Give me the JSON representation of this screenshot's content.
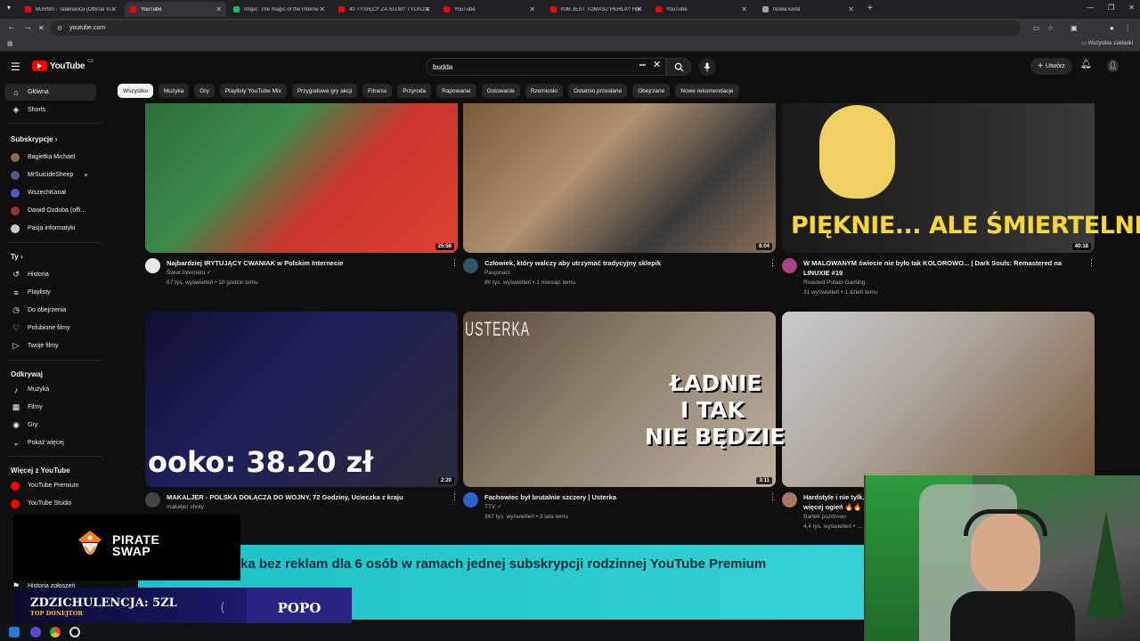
{
  "browser": {
    "tabs": [
      {
        "title": "BURNS - Talamanca (Official Vi",
        "color": "#ff0000",
        "active": false
      },
      {
        "title": "YouTube",
        "color": "#ff0000",
        "active": true
      },
      {
        "title": "Imgur: The magic of the Interne",
        "color": "#1bb76e",
        "active": false
      },
      {
        "title": "40 TYSIĘCY ZA ŚLUB? TYLKO D",
        "color": "#ff0000",
        "active": false
      },
      {
        "title": "YouTube",
        "color": "#ff0000",
        "active": false
      },
      {
        "title": "KIM JEST TOMASZ PERŁA? Hist",
        "color": "#ff0000",
        "active": false
      },
      {
        "title": "YouTube",
        "color": "#ff0000",
        "active": false
      },
      {
        "title": "Nowa karta",
        "color": "#9aa0a6",
        "active": false
      }
    ],
    "url": "youtube.com",
    "bookmarks_folder": "Wszystkie zakładki"
  },
  "header": {
    "logo": "YouTube",
    "logo_country": "CZ",
    "search_value": "budda",
    "create_label": "Utwórz"
  },
  "sidebar": {
    "main": [
      {
        "label": "Główna",
        "icon": "home-icon",
        "glyph": "⌂",
        "active": true
      },
      {
        "label": "Shorts",
        "icon": "shorts-icon",
        "glyph": "◈",
        "active": false
      }
    ],
    "subs_heading": "Subskrypcje",
    "subs": [
      {
        "label": "Bagietka Michael",
        "color": "#8a6a50"
      },
      {
        "label": "MrSuicideSheep",
        "color": "#5a5a8a",
        "new": true
      },
      {
        "label": "WszechKanał",
        "color": "#5555cc"
      },
      {
        "label": "Dawid Ozdoba (offi...",
        "color": "#993333"
      },
      {
        "label": "Pasja informatyki",
        "color": "#cccccc"
      }
    ],
    "you_heading": "Ty",
    "you": [
      {
        "label": "Historia",
        "icon": "history-icon",
        "glyph": "↺"
      },
      {
        "label": "Playlisty",
        "icon": "playlist-icon",
        "glyph": "≡"
      },
      {
        "label": "Do obejrzenia",
        "icon": "watch-later-icon",
        "glyph": "◷"
      },
      {
        "label": "Polubione filmy",
        "icon": "thumb-up-icon",
        "glyph": "♡"
      },
      {
        "label": "Twoje filmy",
        "icon": "your-videos-icon",
        "glyph": "▷"
      }
    ],
    "explore_heading": "Odkrywaj",
    "explore": [
      {
        "label": "Muzyka",
        "icon": "music-icon",
        "glyph": "♪"
      },
      {
        "label": "Filmy",
        "icon": "film-icon",
        "glyph": "▦"
      },
      {
        "label": "Gry",
        "icon": "gaming-icon",
        "glyph": "◉"
      },
      {
        "label": "Pokaż więcej",
        "icon": "chevron-down-icon",
        "glyph": "⌄"
      }
    ],
    "more_heading": "Więcej z YouTube",
    "more": [
      {
        "label": "YouTube Premium",
        "color": "#ff0000"
      },
      {
        "label": "YouTube Studio",
        "color": "#ff0000"
      }
    ],
    "bottom_item": "Historia zgłoszeń"
  },
  "chips": [
    "Wszystko",
    "Muzyka",
    "Gry",
    "Playlisty YouTube Mix",
    "Przygodowe gry akcji",
    "Fitness",
    "Przyroda",
    "Rapowanie",
    "Gotowanie",
    "Rzemiosło",
    "Ostatnio przesłane",
    "Obejrzane",
    "Nowe rekomendacje"
  ],
  "videos": [
    {
      "title": "Najbardziej IRYTUJĄCY CWANIAK w Polskim Internecie",
      "title2": "",
      "channel": "Świat Internetu ✓",
      "meta": "67 tys. wyświetleń • 10 godzin temu",
      "duration": "25:56",
      "thumb": "linear-gradient(135deg,#2d6e3c 0%,#3b8a4a 35%,#c8352c 60%,#e04030 100%)",
      "avatar": "#e8e8e8"
    },
    {
      "title": "Człowiek, który walczy aby utrzymać tradycyjny sklepik",
      "title2": "",
      "channel": "Pasjonaci",
      "meta": "80 tys. wyświetleń • 1 miesiąc temu",
      "duration": "8:04",
      "thumb": "linear-gradient(135deg,#7a5a3a 0%,#b09070 40%,#3a3a3a 70%,#8a7058 100%)",
      "avatar": "#335566"
    },
    {
      "title": "W MALOWANYM świecie nie było tak KOLOROWO... | Dark Souls: Remastered na",
      "title2": "LINUXIE #19",
      "channel": "Roasted Potato Gaming",
      "meta": "31 wyświetleń • 1 dzień temu",
      "duration": "40:18",
      "thumb": "linear-gradient(90deg,#1a1a1a 0%,#2a2a2a 60%,#3a3a3a 100%)",
      "avatar": "#aa4488"
    },
    {
      "title": "MAKALJER - POLSKA DOŁĄCZA DO WOJNY, 72 Godziny, Ucieczka z kraju",
      "title2": "",
      "channel": "makaljer shoty",
      "meta": "…emu",
      "duration": "2:20",
      "thumb": "linear-gradient(135deg,#101030 0%,#1e1e5a 40%,#2a2a3a 100%)",
      "avatar": "#444"
    },
    {
      "title": "Fachowiec był brutalnie szczery | Usterka",
      "title2": "",
      "channel": "TTV ✓",
      "meta": "367 tys. wyświetleń • 3 lata temu",
      "duration": "3:11",
      "thumb": "linear-gradient(135deg,#5a4a3a 0%,#8a7a68 40%,#c0b0a0 100%)",
      "avatar": "#3060cc"
    },
    {
      "title": "Hardstyle i nie tylk…",
      "title2": "więcej ogień 🔥🔥",
      "channel": "Bartek pozdrooo",
      "meta": "4,4 tys. wyświetleń • …",
      "duration": "",
      "thumb": "linear-gradient(135deg,#c8c8cc 0%,#b0a8a0 40%,#7a5a3a 100%)",
      "avatar": "#aa7766"
    }
  ],
  "thumb_texts": {
    "v3_big": "PIĘKNIE... ALE ŚMIERTELNIE",
    "v4_big": "ooko: 38.20 zł",
    "v5_lines": [
      "ŁADNIE",
      "I TAK",
      "NIE BĘDZIE"
    ],
    "v5_brand": "USTERKA"
  },
  "overlays": {
    "banner": "ka bez reklam dla 6 osób w ramach jednej subskrypcji rodzinnej YouTube Premium",
    "pirate_line1": "PIRATE",
    "pirate_line2": "SWAP",
    "donor_name": "ZDZICHULENCJA: 5ZL",
    "donor_sub": "TOP DONEJTOR",
    "donor_right": "POPO"
  },
  "colors": {
    "accent": "#ff0000",
    "banner": "#1cc2c6",
    "link": "#3ea6ff"
  }
}
